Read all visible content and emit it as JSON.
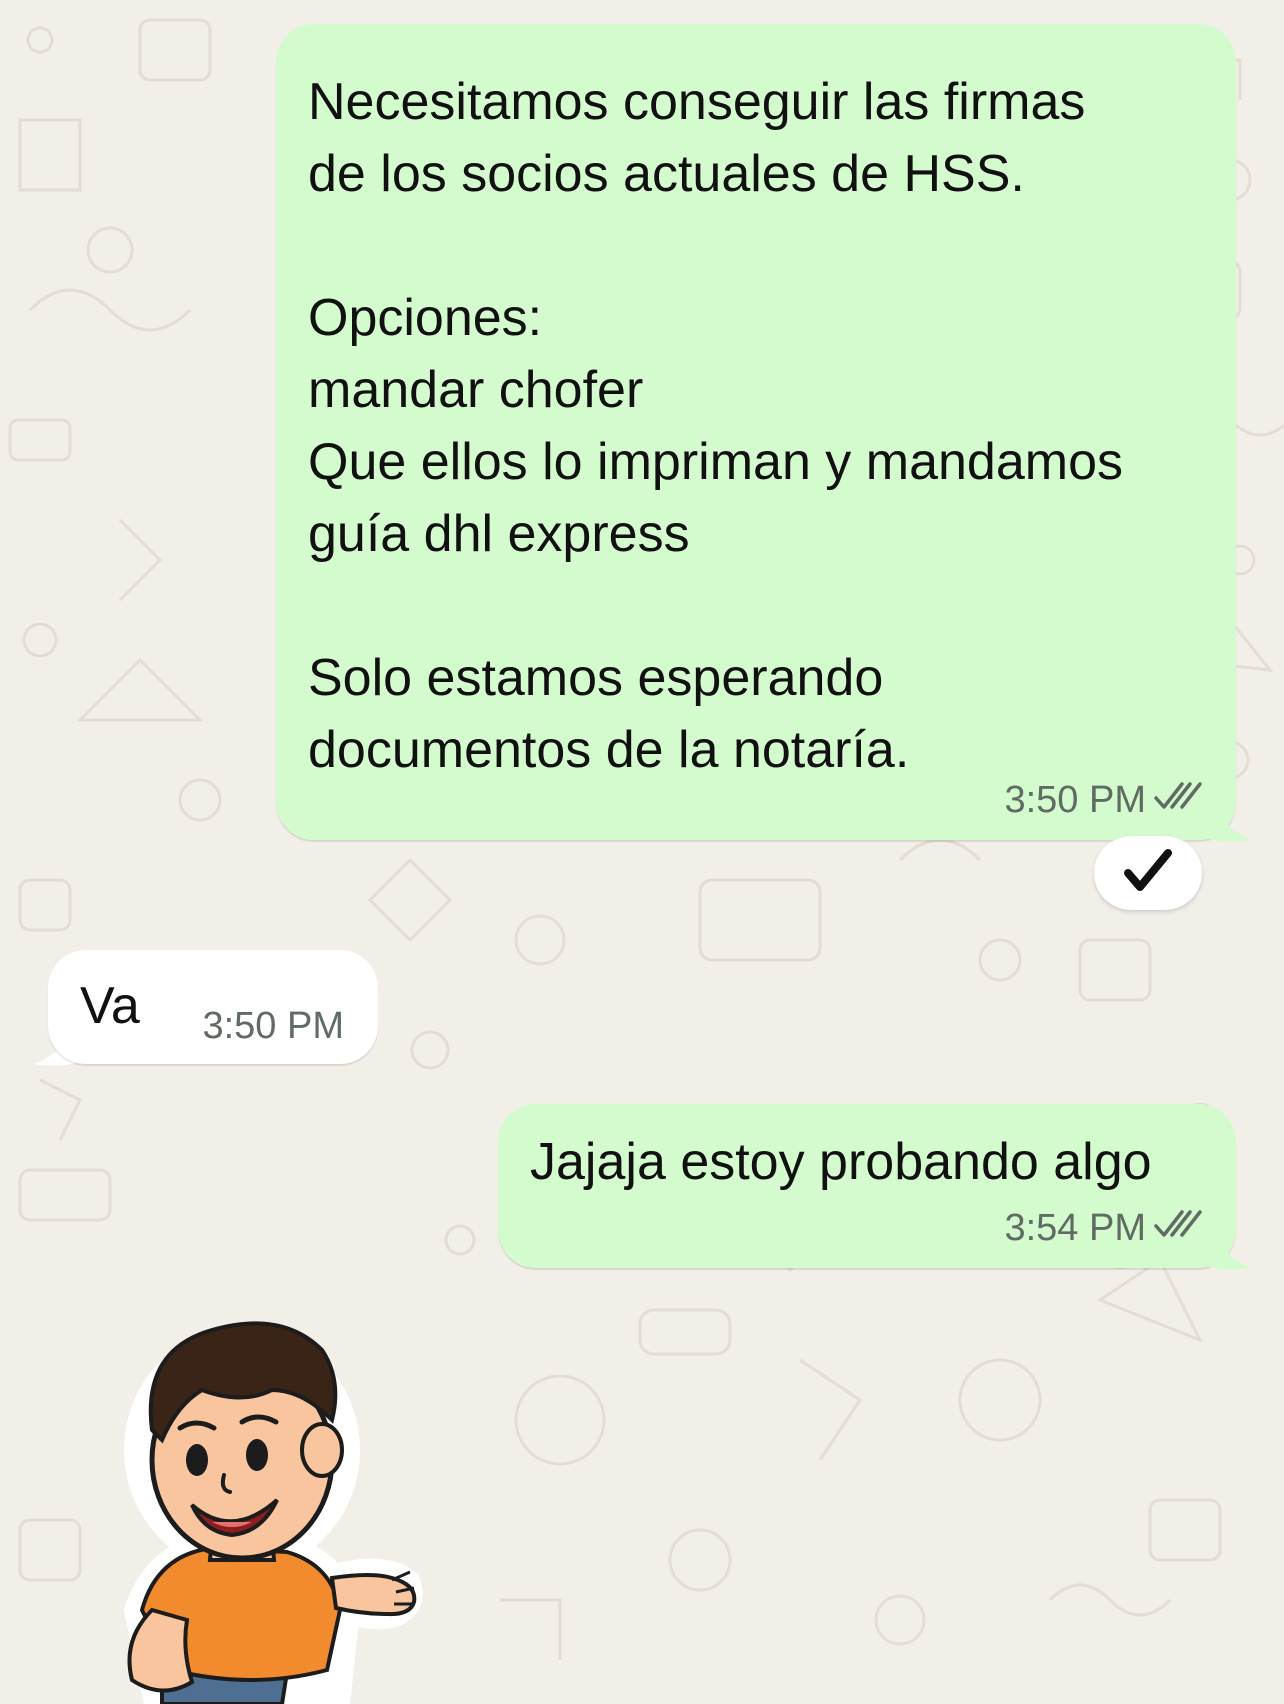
{
  "chat": {
    "messages": [
      {
        "direction": "outgoing",
        "text": "Necesitamos conseguir las firmas\nde los socios actuales de HSS.\n\nOpciones:\nmandar chofer\nQue ellos lo impriman y mandamos\nguía dhl express\n\nSolo estamos esperando\ndocumentos de la notaría.",
        "time": "3:50 PM",
        "status_icon": "double-check-icon",
        "reaction": "✔️"
      },
      {
        "direction": "incoming",
        "text": "Va",
        "time": "3:50 PM"
      },
      {
        "direction": "outgoing",
        "text": "Jajaja estoy probando algo",
        "time": "3:54 PM",
        "status_icon": "double-check-icon"
      },
      {
        "direction": "outgoing",
        "type": "sticker",
        "sticker": "cartoon-boy-sticker"
      }
    ]
  },
  "colors": {
    "wallpaper": "#F2EFE8",
    "outgoing_bubble": "#D4FBCE",
    "incoming_bubble": "#FFFFFF",
    "meta_text": "#5F6B63"
  }
}
